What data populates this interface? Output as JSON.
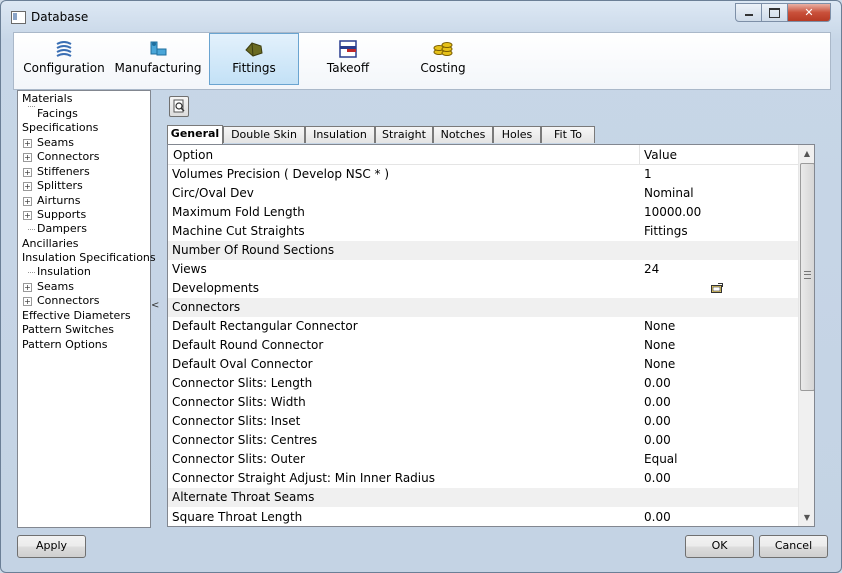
{
  "window": {
    "title": "Database"
  },
  "toolbar": {
    "buttons": [
      {
        "label": "Configuration",
        "icon": "configuration-icon"
      },
      {
        "label": "Manufacturing",
        "icon": "manufacturing-icon"
      },
      {
        "label": "Fittings",
        "icon": "fittings-icon",
        "selected": true
      },
      {
        "label": "Takeoff",
        "icon": "takeoff-icon"
      },
      {
        "label": "Costing",
        "icon": "costing-icon"
      }
    ]
  },
  "tree": {
    "items": [
      {
        "label": "Materials"
      },
      {
        "label": "Facings"
      },
      {
        "label": "Specifications"
      },
      {
        "label": "Seams"
      },
      {
        "label": "Connectors"
      },
      {
        "label": "Stiffeners"
      },
      {
        "label": "Splitters"
      },
      {
        "label": "Airturns"
      },
      {
        "label": "Supports"
      },
      {
        "label": "Dampers"
      },
      {
        "label": "Ancillaries"
      },
      {
        "label": "Insulation Specifications"
      },
      {
        "label": "Insulation"
      },
      {
        "label": "Seams"
      },
      {
        "label": "Connectors"
      },
      {
        "label": "Effective Diameters"
      },
      {
        "label": "Pattern Switches"
      },
      {
        "label": "Pattern Options"
      }
    ]
  },
  "splitter": {
    "glyph": "<"
  },
  "tabs": [
    "General",
    "Double Skin",
    "Insulation",
    "Straight",
    "Notches",
    "Holes",
    "Fit To"
  ],
  "grid": {
    "headers": {
      "option": "Option",
      "value": "Value"
    },
    "rows": [
      {
        "option": "Volumes Precision ( Develop NSC * )",
        "value": "1"
      },
      {
        "option": "Circ/Oval Dev",
        "value": "Nominal"
      },
      {
        "option": "Maximum Fold Length",
        "value": "10000.00"
      },
      {
        "option": "Machine Cut Straights",
        "value": "Fittings"
      },
      {
        "option": "Number Of Round Sections",
        "value": ""
      },
      {
        "option": "Views",
        "value": "24"
      },
      {
        "option": "Developments",
        "value": ""
      },
      {
        "option": "Connectors",
        "value": ""
      },
      {
        "option": "Default Rectangular Connector",
        "value": "None"
      },
      {
        "option": "Default Round Connector",
        "value": "None"
      },
      {
        "option": "Default Oval Connector",
        "value": "None"
      },
      {
        "option": "Connector Slits: Length",
        "value": "0.00"
      },
      {
        "option": "Connector Slits: Width",
        "value": "0.00"
      },
      {
        "option": "Connector Slits: Inset",
        "value": "0.00"
      },
      {
        "option": "Connector Slits: Centres",
        "value": "0.00"
      },
      {
        "option": "Connector Slits: Outer",
        "value": "Equal"
      },
      {
        "option": "Connector Straight Adjust: Min Inner Radius",
        "value": "0.00"
      },
      {
        "option": "Alternate Throat Seams",
        "value": ""
      },
      {
        "option": "Square Throat Length",
        "value": "0.00"
      }
    ]
  },
  "buttons": {
    "apply": "Apply",
    "ok": "OK",
    "cancel": "Cancel"
  }
}
